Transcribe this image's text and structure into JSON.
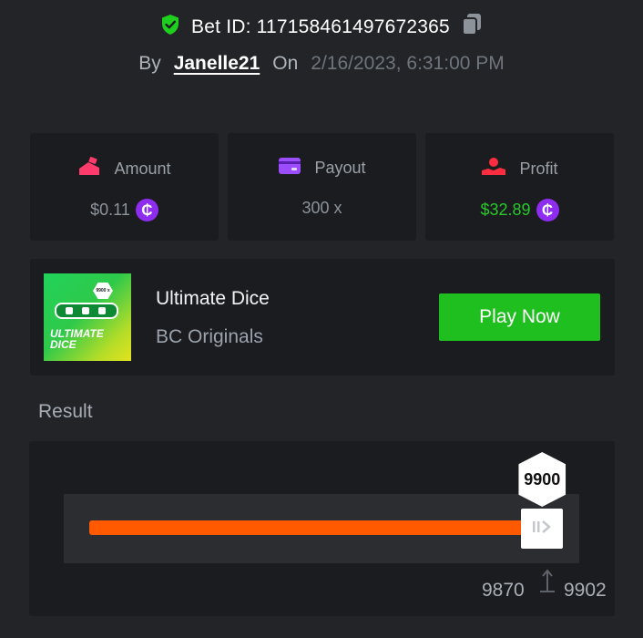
{
  "header": {
    "bet_id_label": "Bet ID: 117158461497672365",
    "by_label": "By",
    "username": "Janelle21",
    "on_label": "On",
    "datetime": "2/16/2023, 6:31:00 PM"
  },
  "stats": {
    "amount": {
      "label": "Amount",
      "value": "$0.11",
      "icon": "bet-amount-icon"
    },
    "payout": {
      "label": "Payout",
      "value": "300 x",
      "icon": "card-icon"
    },
    "profit": {
      "label": "Profit",
      "value": "$32.89",
      "icon": "profit-hand-icon"
    },
    "currency_symbol": "₵"
  },
  "game": {
    "title": "Ultimate Dice",
    "provider": "BC Originals",
    "play_label": "Play Now",
    "thumb_badge": "9900 x",
    "thumb_text_line1": "ULTIMATE",
    "thumb_text_line2": "DICE"
  },
  "result": {
    "title": "Result",
    "value": "9900",
    "range_min": "9870",
    "range_max": "9902",
    "fill_fraction": 0.9375
  },
  "colors": {
    "background": "#232428",
    "card": "#1b1c1f",
    "accent_green": "#1fbf1f",
    "profit_green": "#28c828",
    "coin_purple": "#8e2cf0",
    "slider_orange": "#ff5a00"
  }
}
